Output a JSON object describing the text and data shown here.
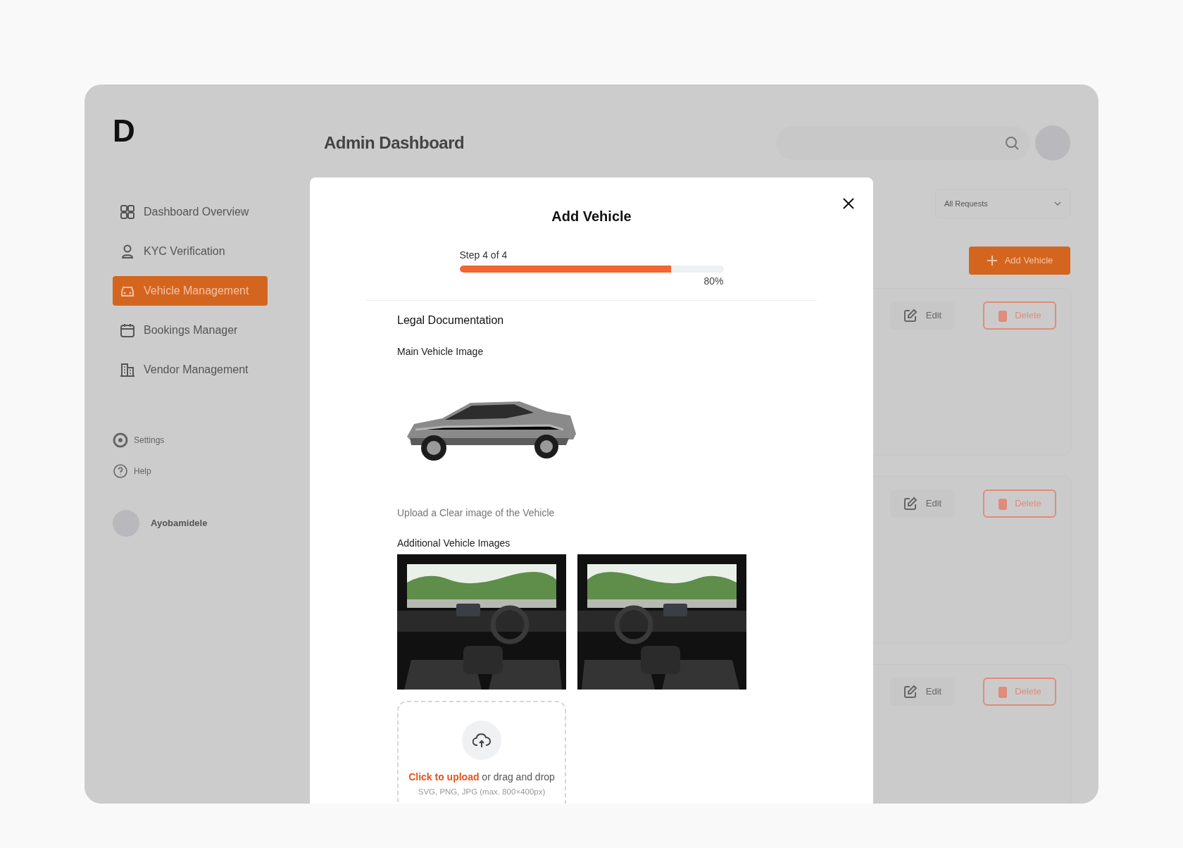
{
  "sidebar": {
    "logo": "D",
    "items": [
      {
        "label": "Dashboard Overview",
        "selected": false
      },
      {
        "label": "KYC Verification",
        "selected": false
      },
      {
        "label": "Vehicle Management",
        "selected": true
      },
      {
        "label": "Bookings Manager",
        "selected": false
      },
      {
        "label": "Vendor Management",
        "selected": false
      }
    ],
    "footer_items": [
      {
        "label": "Settings"
      },
      {
        "label": "Help"
      }
    ],
    "user": {
      "name": "Ayobamidele"
    }
  },
  "header": {
    "title": "Admin Dashboard"
  },
  "toolbar": {
    "filter": "All Requests",
    "add_button": "Add Vehicle"
  },
  "vehicle_cards": [
    {
      "edit": "Edit",
      "delete": "Delete"
    },
    {
      "edit": "Edit",
      "delete": "Delete"
    },
    {
      "edit": "Edit",
      "delete": "Delete"
    }
  ],
  "modal": {
    "title": "Add Vehicle",
    "step": "Step 4 of 4",
    "level": 0.8,
    "percent": "80%",
    "section": "Legal Documentation",
    "main_image_label": "Main Vehicle Image",
    "main_image": {
      "kind": "picture"
    },
    "hint": "Upload a Clear image of the Vehicle",
    "additional_label": "Additional Vehicle Images",
    "additional_images": [
      {
        "kind": "picture"
      },
      {
        "kind": "picture"
      }
    ],
    "upload": {
      "link": "Click to upload",
      "text": "or drag and drop",
      "formats": "SVG, PNG, JPG (max. 800×400px)"
    }
  }
}
